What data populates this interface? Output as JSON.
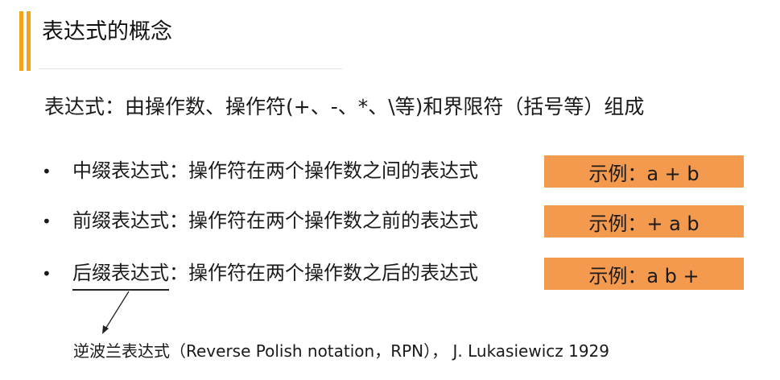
{
  "title": "表达式的概念",
  "definition": "表达式：由操作数、操作符(+、-、*、\\等)和界限符（括号等）组成",
  "items": [
    {
      "term": "中缀表达式",
      "rest": "：操作符在两个操作数之间的表达式",
      "example": "示例：a + b"
    },
    {
      "term": "前缀表达式",
      "rest": "：操作符在两个操作数之前的表达式",
      "example": "示例：+ a b"
    },
    {
      "term": "后缀表达式",
      "rest": "：操作符在两个操作数之后的表达式",
      "example": "示例：a b +"
    }
  ],
  "bullet": "•",
  "note": "逆波兰表达式（Reverse Polish notation，RPN），  J. Lukasiewicz  1929",
  "colors": {
    "accent": "#f2a51a",
    "example_box": "#f39a4f"
  }
}
